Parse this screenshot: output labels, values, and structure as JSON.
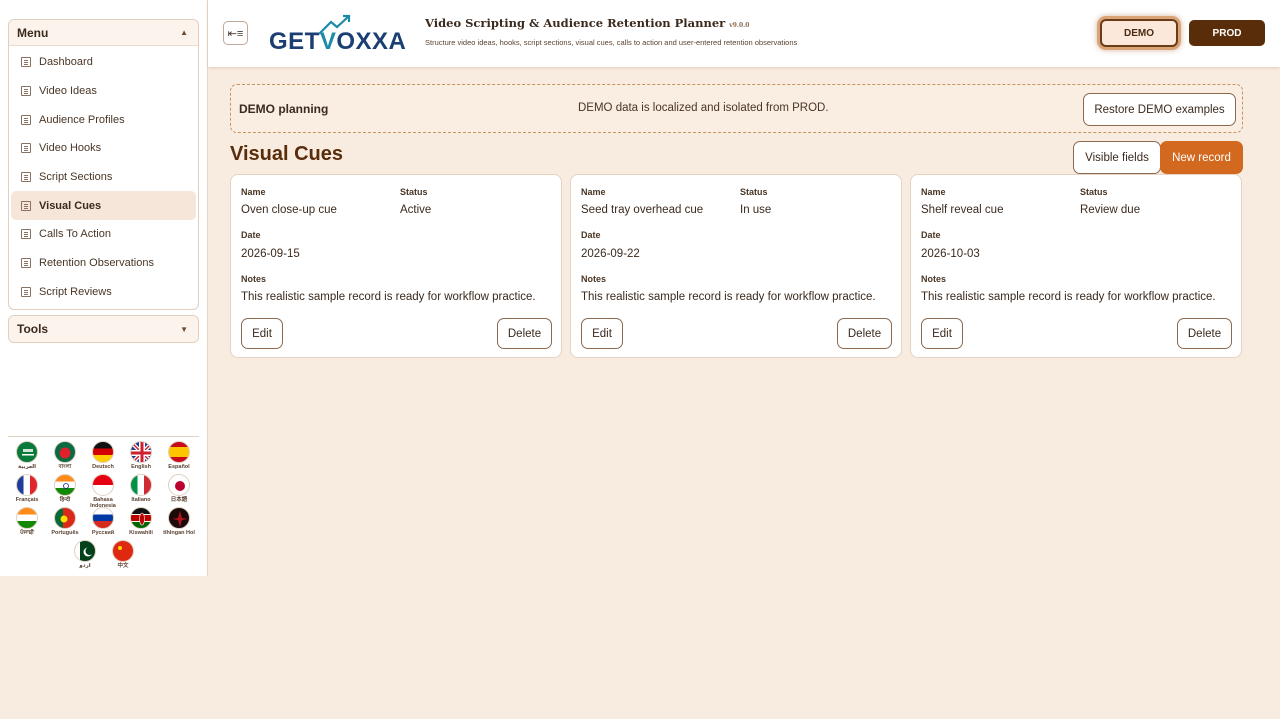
{
  "sidebar": {
    "menu_title": "Menu",
    "tools_title": "Tools",
    "items": [
      {
        "label": "Dashboard"
      },
      {
        "label": "Video Ideas"
      },
      {
        "label": "Audience Profiles"
      },
      {
        "label": "Video Hooks"
      },
      {
        "label": "Script Sections"
      },
      {
        "label": "Visual Cues",
        "active": true
      },
      {
        "label": "Calls To Action"
      },
      {
        "label": "Retention Observations"
      },
      {
        "label": "Script Reviews"
      }
    ],
    "languages": [
      {
        "label": "العربية",
        "flag": "saudi-arabia"
      },
      {
        "label": "বাংলা",
        "flag": "bangladesh"
      },
      {
        "label": "Deutsch",
        "flag": "germany"
      },
      {
        "label": "English",
        "flag": "united-kingdom"
      },
      {
        "label": "Español",
        "flag": "spain"
      },
      {
        "label": "Français",
        "flag": "france"
      },
      {
        "label": "हिन्दी",
        "flag": "india"
      },
      {
        "label": "Bahasa Indonesia",
        "flag": "indonesia"
      },
      {
        "label": "Italiano",
        "flag": "italy"
      },
      {
        "label": "日本語",
        "flag": "japan"
      },
      {
        "label": "ਪੰਜਾਬੀ",
        "flag": "india"
      },
      {
        "label": "Português",
        "flag": "portugal"
      },
      {
        "label": "Русский",
        "flag": "russia"
      },
      {
        "label": "Kiswahili",
        "flag": "kenya"
      },
      {
        "label": "tlhIngan Hol",
        "flag": "klingon"
      },
      {
        "label": "اردو",
        "flag": "pakistan"
      },
      {
        "label": "中文",
        "flag": "china"
      }
    ]
  },
  "header": {
    "logo_text_left": "GET",
    "logo_text_v": "V",
    "logo_text_right": "OXXA",
    "title": "Video Scripting & Audience Retention Planner",
    "version": "v9.0.0",
    "subtitle": "Structure video ideas, hooks, script sections, visual cues, calls to action and user-entered retention observations",
    "env_demo": "DEMO",
    "env_prod": "PROD"
  },
  "banner": {
    "title": "DEMO planning",
    "message": "DEMO data is localized and isolated from PROD.",
    "restore_label": "Restore DEMO examples"
  },
  "main": {
    "section_title": "Visual Cues",
    "visible_fields_label": "Visible fields",
    "new_record_label": "New record",
    "field_labels": {
      "name": "Name",
      "status": "Status",
      "date": "Date",
      "notes": "Notes"
    },
    "edit_label": "Edit",
    "delete_label": "Delete",
    "records": [
      {
        "name": "Oven close-up cue",
        "status": "Active",
        "date": "2026-09-15",
        "notes": "This realistic sample record is ready for workflow practice."
      },
      {
        "name": "Seed tray overhead cue",
        "status": "In use",
        "date": "2026-09-22",
        "notes": "This realistic sample record is ready for workflow practice."
      },
      {
        "name": "Shelf reveal cue",
        "status": "Review due",
        "date": "2026-10-03",
        "notes": "This realistic sample record is ready for workflow practice."
      }
    ]
  }
}
